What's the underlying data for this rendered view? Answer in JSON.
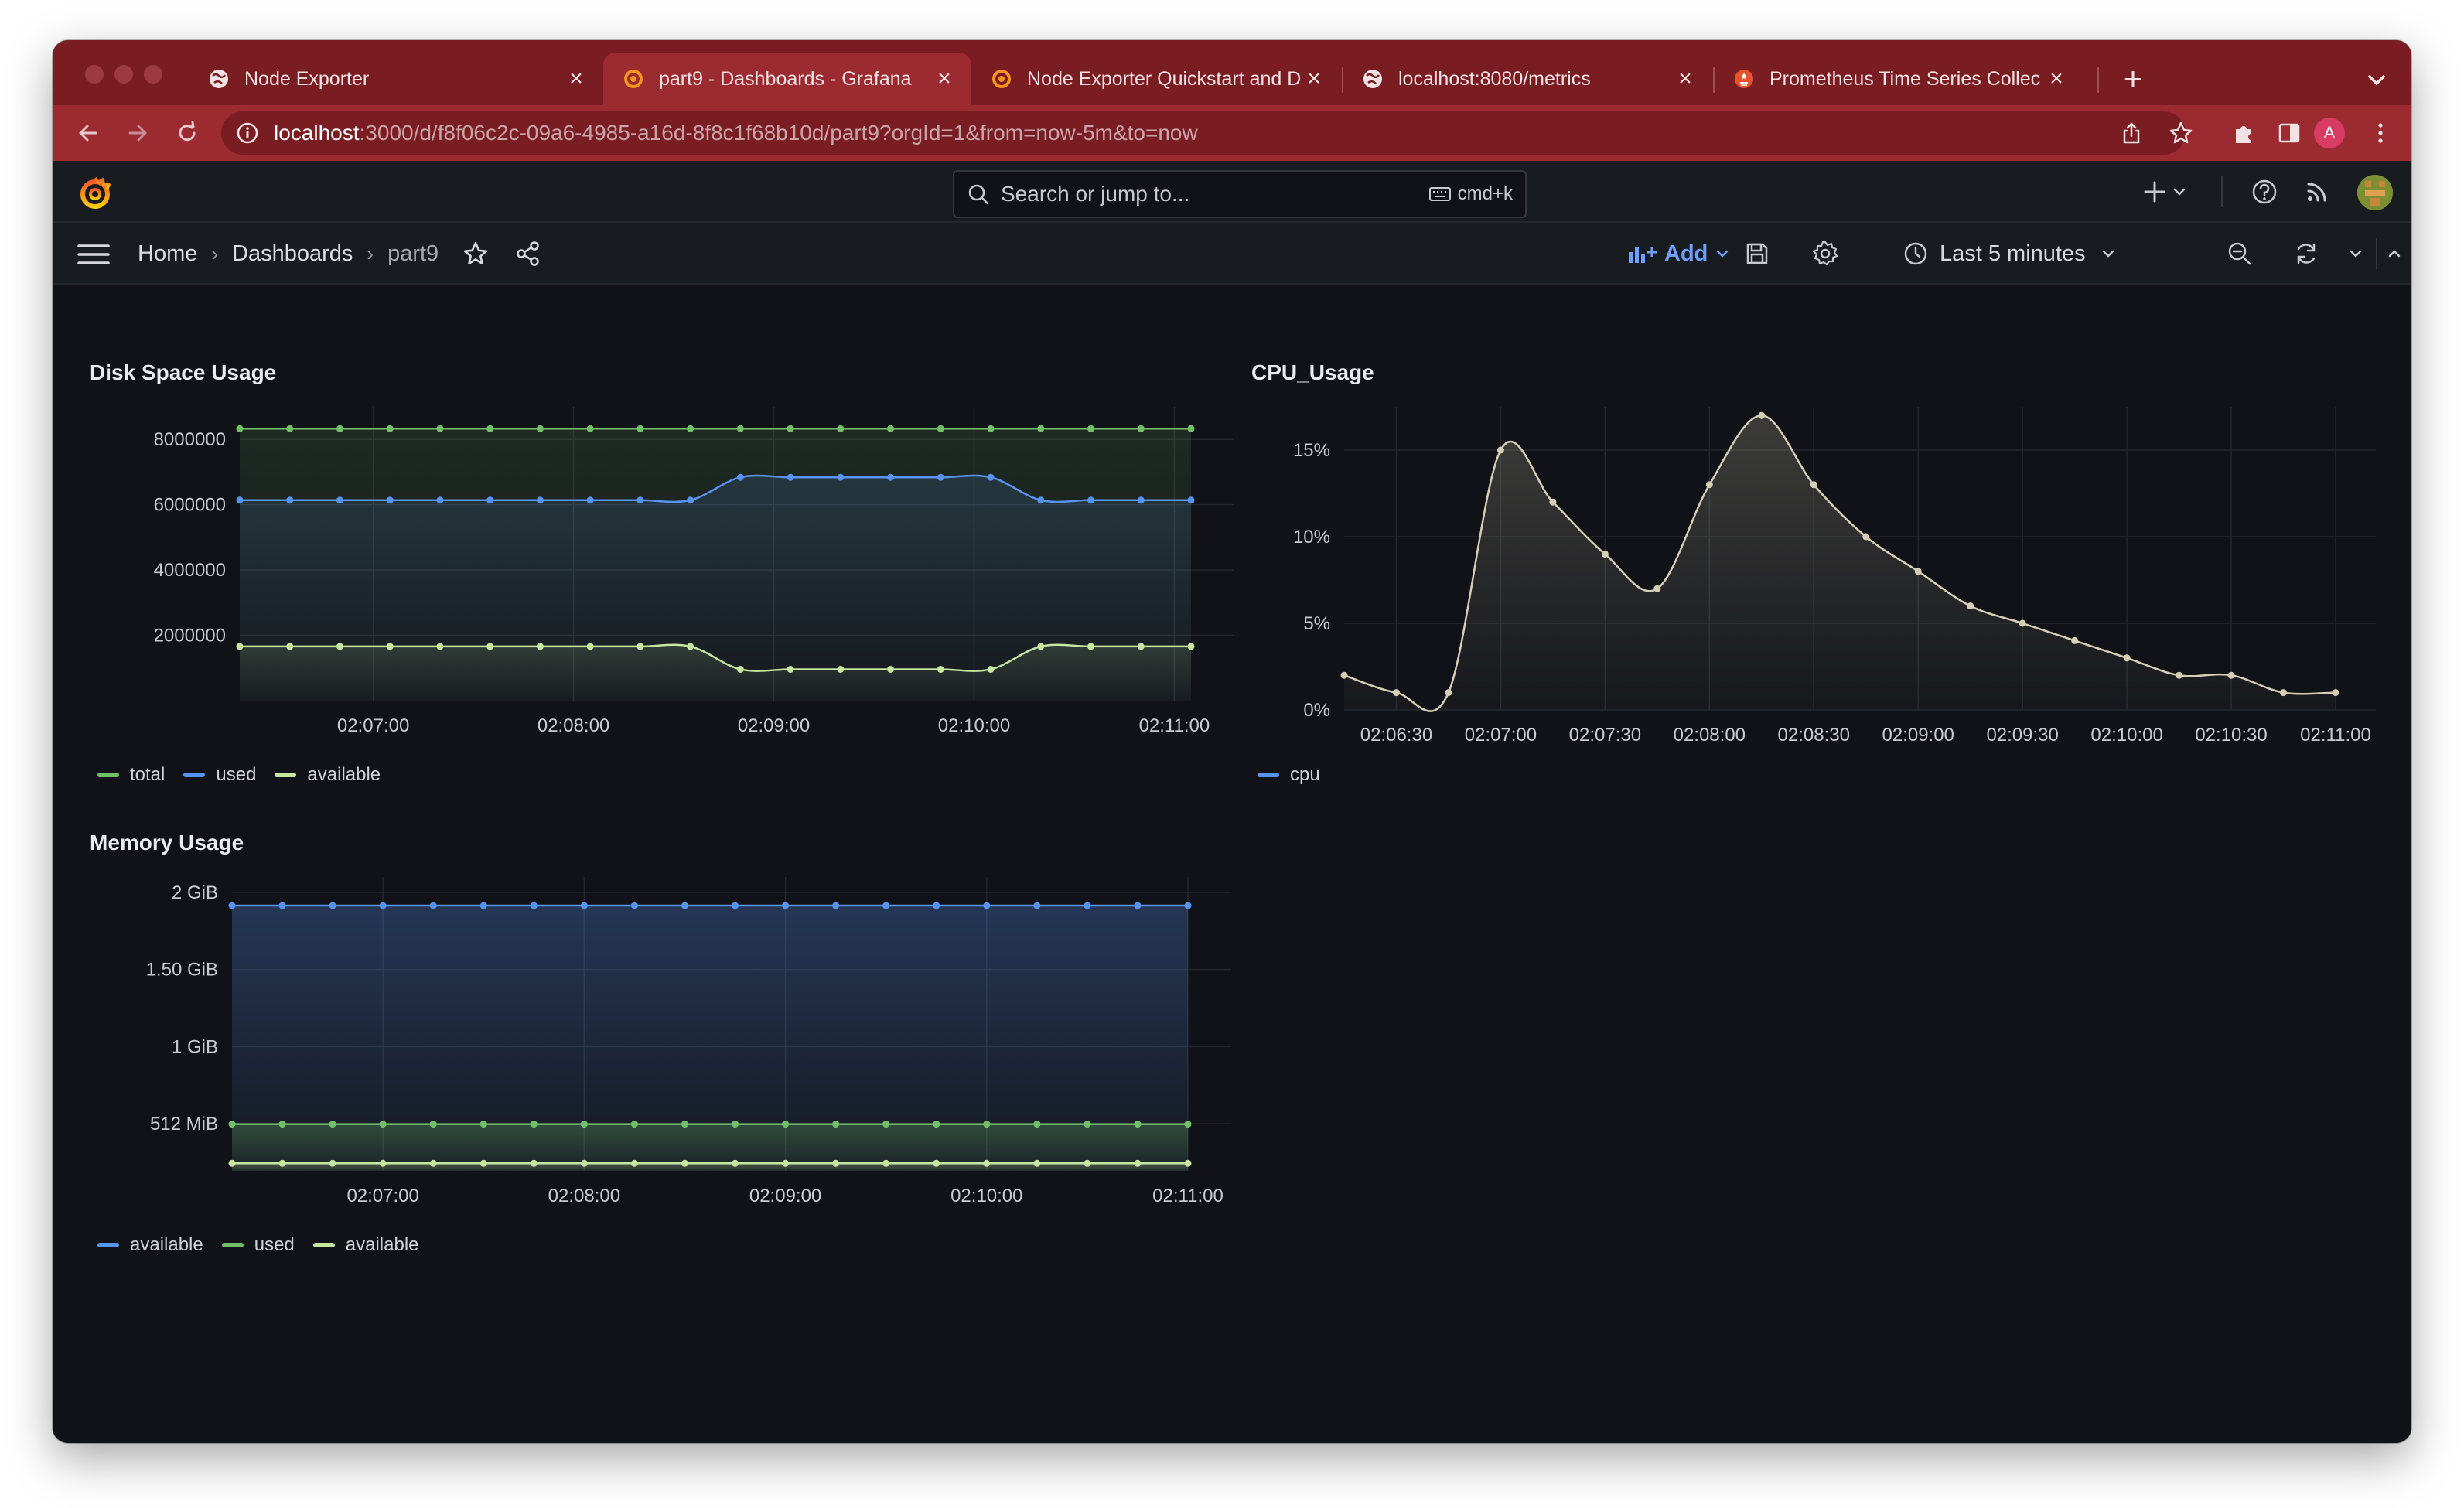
{
  "browser": {
    "tabs": [
      {
        "title": "Node Exporter",
        "favicon": "globe-icon",
        "active": false
      },
      {
        "title": "part9 - Dashboards - Grafana",
        "favicon": "grafana-icon",
        "active": true
      },
      {
        "title": "Node Exporter Quickstart and D",
        "favicon": "grafana-icon",
        "active": false
      },
      {
        "title": "localhost:8080/metrics",
        "favicon": "globe-icon",
        "active": false
      },
      {
        "title": "Prometheus Time Series Collec",
        "favicon": "prometheus-icon",
        "active": false
      }
    ],
    "close_glyph": "×",
    "new_tab_glyph": "+",
    "url_host": "localhost",
    "url_rest": ":3000/d/f8f06c2c-09a6-4985-a16d-8f8c1f68b10d/part9?orgId=1&from=now-5m&to=now",
    "profile_initial": "A",
    "colors": {
      "tabstrip": "#7a1d23",
      "toolbar": "#9b2a31",
      "profile": "#d83b63"
    }
  },
  "grafana": {
    "search_placeholder": "Search or jump to...",
    "search_shortcut": "cmd+k",
    "breadcrumb": [
      {
        "label": "Home"
      },
      {
        "label": "Dashboards"
      },
      {
        "label": "part9"
      }
    ],
    "breadcrumb_sep": "›",
    "add_label": "Add",
    "time_range_label": "Last 5 minutes",
    "colors": {
      "background": "#111217",
      "topbar": "#181b1f",
      "accent_blue": "#6e9fff",
      "logo": "#f46800"
    }
  },
  "panels": {
    "disk": {
      "title": "Disk Space Usage"
    },
    "cpu": {
      "title": "CPU_Usage"
    },
    "memory": {
      "title": "Memory Usage"
    }
  },
  "chart_data": [
    {
      "id": "disk",
      "type": "line",
      "title": "Disk Space Usage",
      "x": [
        "02:06:20",
        "02:06:35",
        "02:06:50",
        "02:07:05",
        "02:07:20",
        "02:07:35",
        "02:07:50",
        "02:08:05",
        "02:08:20",
        "02:08:35",
        "02:08:50",
        "02:09:05",
        "02:09:20",
        "02:09:35",
        "02:09:50",
        "02:10:05",
        "02:10:20",
        "02:10:35",
        "02:10:50",
        "02:11:05"
      ],
      "x_ticks": [
        "02:07:00",
        "02:08:00",
        "02:09:00",
        "02:10:00",
        "02:11:00"
      ],
      "y_ticks": [
        "2000000",
        "4000000",
        "6000000",
        "8000000"
      ],
      "ylim": [
        0,
        9000000
      ],
      "series": [
        {
          "name": "total",
          "color": "#73bf69",
          "values": [
            8330000,
            8330000,
            8330000,
            8330000,
            8330000,
            8330000,
            8330000,
            8330000,
            8330000,
            8330000,
            8330000,
            8330000,
            8330000,
            8330000,
            8330000,
            8330000,
            8330000,
            8330000,
            8330000,
            8330000
          ]
        },
        {
          "name": "used",
          "color": "#5794f2",
          "values": [
            6140000,
            6140000,
            6140000,
            6140000,
            6140000,
            6140000,
            6140000,
            6140000,
            6140000,
            6140000,
            6840000,
            6840000,
            6840000,
            6840000,
            6840000,
            6840000,
            6140000,
            6140000,
            6140000,
            6140000
          ]
        },
        {
          "name": "available",
          "color": "#c8e6a0",
          "values": [
            1660000,
            1660000,
            1660000,
            1660000,
            1660000,
            1660000,
            1660000,
            1660000,
            1660000,
            1660000,
            960000,
            960000,
            960000,
            960000,
            960000,
            960000,
            1660000,
            1660000,
            1660000,
            1660000
          ]
        }
      ],
      "grid": true,
      "legend": "bottom-left"
    },
    {
      "id": "cpu",
      "type": "area",
      "title": "CPU_Usage",
      "x": [
        "02:06:15",
        "02:06:30",
        "02:06:45",
        "02:07:00",
        "02:07:15",
        "02:07:30",
        "02:07:45",
        "02:08:00",
        "02:08:15",
        "02:08:30",
        "02:08:45",
        "02:09:00",
        "02:09:15",
        "02:09:30",
        "02:09:45",
        "02:10:00",
        "02:10:15",
        "02:10:30",
        "02:10:45",
        "02:11:00"
      ],
      "x_ticks": [
        "02:06:30",
        "02:07:00",
        "02:07:30",
        "02:08:00",
        "02:08:30",
        "02:09:00",
        "02:09:30",
        "02:10:00",
        "02:10:30",
        "02:11:00"
      ],
      "y_ticks": [
        "0%",
        "5%",
        "10%",
        "15%"
      ],
      "ylim": [
        0,
        17.5
      ],
      "series": [
        {
          "name": "cpu",
          "color": "#d5d0b5",
          "values": [
            2,
            1,
            1,
            15,
            12,
            9,
            7,
            13,
            17,
            13,
            10,
            8,
            6,
            5,
            4,
            3,
            2,
            2,
            1,
            1
          ]
        }
      ],
      "legend_color": "#5794f2",
      "grid": true,
      "legend": "bottom-left"
    },
    {
      "id": "memory",
      "type": "line",
      "title": "Memory Usage",
      "x": [
        "02:06:15",
        "02:06:30",
        "02:06:45",
        "02:07:00",
        "02:07:15",
        "02:07:30",
        "02:07:45",
        "02:08:00",
        "02:08:15",
        "02:08:30",
        "02:08:45",
        "02:09:00",
        "02:09:15",
        "02:09:30",
        "02:09:45",
        "02:10:00",
        "02:10:15",
        "02:10:30",
        "02:10:45",
        "02:11:00"
      ],
      "x_ticks": [
        "02:07:00",
        "02:08:00",
        "02:09:00",
        "02:10:00",
        "02:11:00"
      ],
      "y_ticks": [
        "512 MiB",
        "1 GiB",
        "1.50 GiB",
        "2 GiB"
      ],
      "y_tick_values_mib": [
        512,
        1024,
        1536,
        2048
      ],
      "ylim_mib": [
        200,
        2150
      ],
      "series": [
        {
          "name": "available",
          "color": "#5794f2",
          "values_mib": [
            1960,
            1960,
            1960,
            1960,
            1960,
            1960,
            1960,
            1960,
            1960,
            1960,
            1960,
            1960,
            1960,
            1960,
            1960,
            1960,
            1960,
            1960,
            1960,
            1960
          ]
        },
        {
          "name": "used",
          "color": "#73bf69",
          "values_mib": [
            510,
            510,
            510,
            510,
            510,
            510,
            510,
            510,
            510,
            510,
            510,
            510,
            510,
            510,
            510,
            510,
            510,
            510,
            510,
            510
          ]
        },
        {
          "name": "available",
          "color": "#c8e6a0",
          "values_mib": [
            250,
            250,
            250,
            250,
            250,
            250,
            250,
            250,
            250,
            250,
            250,
            250,
            250,
            250,
            250,
            250,
            250,
            250,
            250,
            250
          ]
        }
      ],
      "grid": true,
      "legend": "bottom-left"
    }
  ]
}
